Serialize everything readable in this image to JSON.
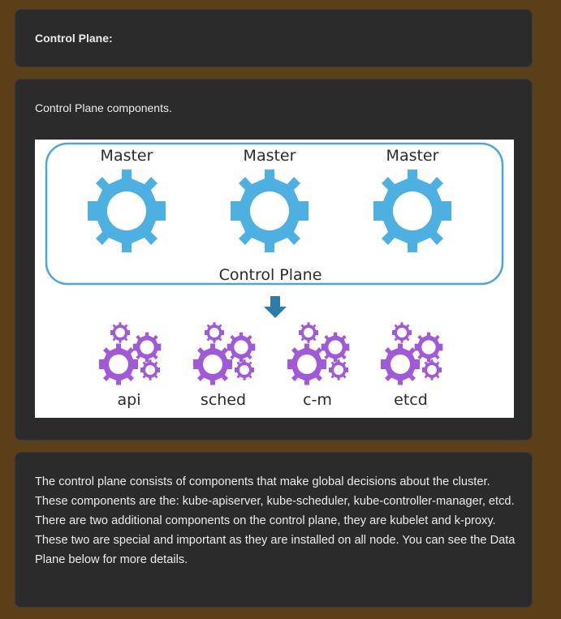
{
  "header": {
    "title": "Control Plane:"
  },
  "diagram_card": {
    "caption": "Control Plane components.",
    "diagram": {
      "group_label": "Control Plane",
      "masters": [
        "Master",
        "Master",
        "Master"
      ],
      "components": [
        "api",
        "sched",
        "c-m",
        "etcd"
      ],
      "colors": {
        "master_gear": "#4db0e0",
        "group_border": "#4aa8d8",
        "arrow": "#2d7bab",
        "component_gear": "#a05ad8"
      }
    }
  },
  "description": {
    "text": "The control plane consists of components that make global decisions about the cluster. These components are the: kube-apiserver, kube-scheduler, kube-controller-manager, etcd. There are two additional components on the control plane, they are kubelet and k-proxy. These two are special and important as they are installed on all node. You can see the Data Plane below for more details."
  }
}
